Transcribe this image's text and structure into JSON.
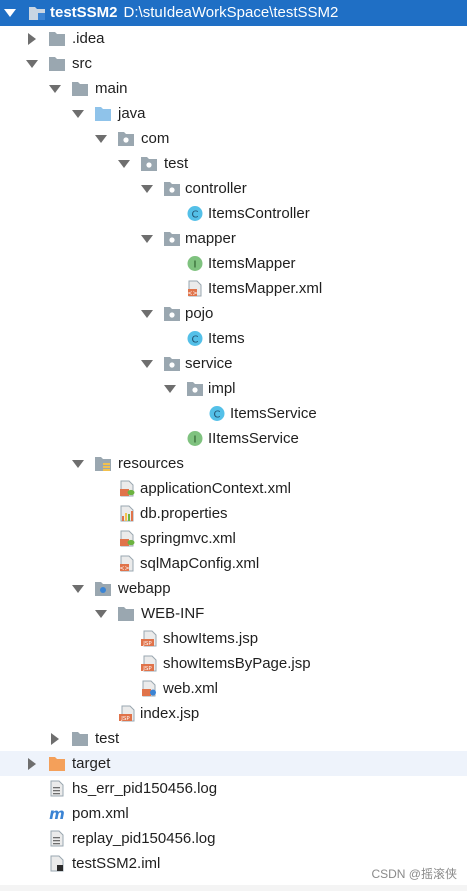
{
  "header": {
    "project": "testSSM2",
    "path": "D:\\stuIdeaWorkSpace\\testSSM2"
  },
  "tree": {
    "idea": ".idea",
    "src": "src",
    "main": "main",
    "java": "java",
    "com": "com",
    "test_pkg": "test",
    "controller": "controller",
    "items_controller": "ItemsController",
    "mapper": "mapper",
    "items_mapper": "ItemsMapper",
    "items_mapper_xml": "ItemsMapper.xml",
    "pojo": "pojo",
    "items": "Items",
    "service": "service",
    "impl": "impl",
    "items_service": "ItemsService",
    "iitems_service": "IItemsService",
    "resources": "resources",
    "app_context": "applicationContext.xml",
    "db_props": "db.properties",
    "springmvc": "springmvc.xml",
    "sqlmap": "sqlMapConfig.xml",
    "webapp": "webapp",
    "webinf": "WEB-INF",
    "show_items": "showItems.jsp",
    "show_items_by_page": "showItemsByPage.jsp",
    "web_xml": "web.xml",
    "index_jsp": "index.jsp",
    "test_dir": "test",
    "target": "target",
    "hs_err": "hs_err_pid150456.log",
    "pom": "pom.xml",
    "replay": "replay_pid150456.log",
    "iml": "testSSM2.iml"
  },
  "watermark": "CSDN @摇滚侠",
  "colors": {
    "header_bg": "#1f6fc5",
    "folder": "#9aa7b0",
    "source_folder": "#8fc3ea",
    "excluded_folder": "#f4a05a",
    "class_icon": "#54c0e8",
    "interface_icon": "#7fc27f"
  }
}
